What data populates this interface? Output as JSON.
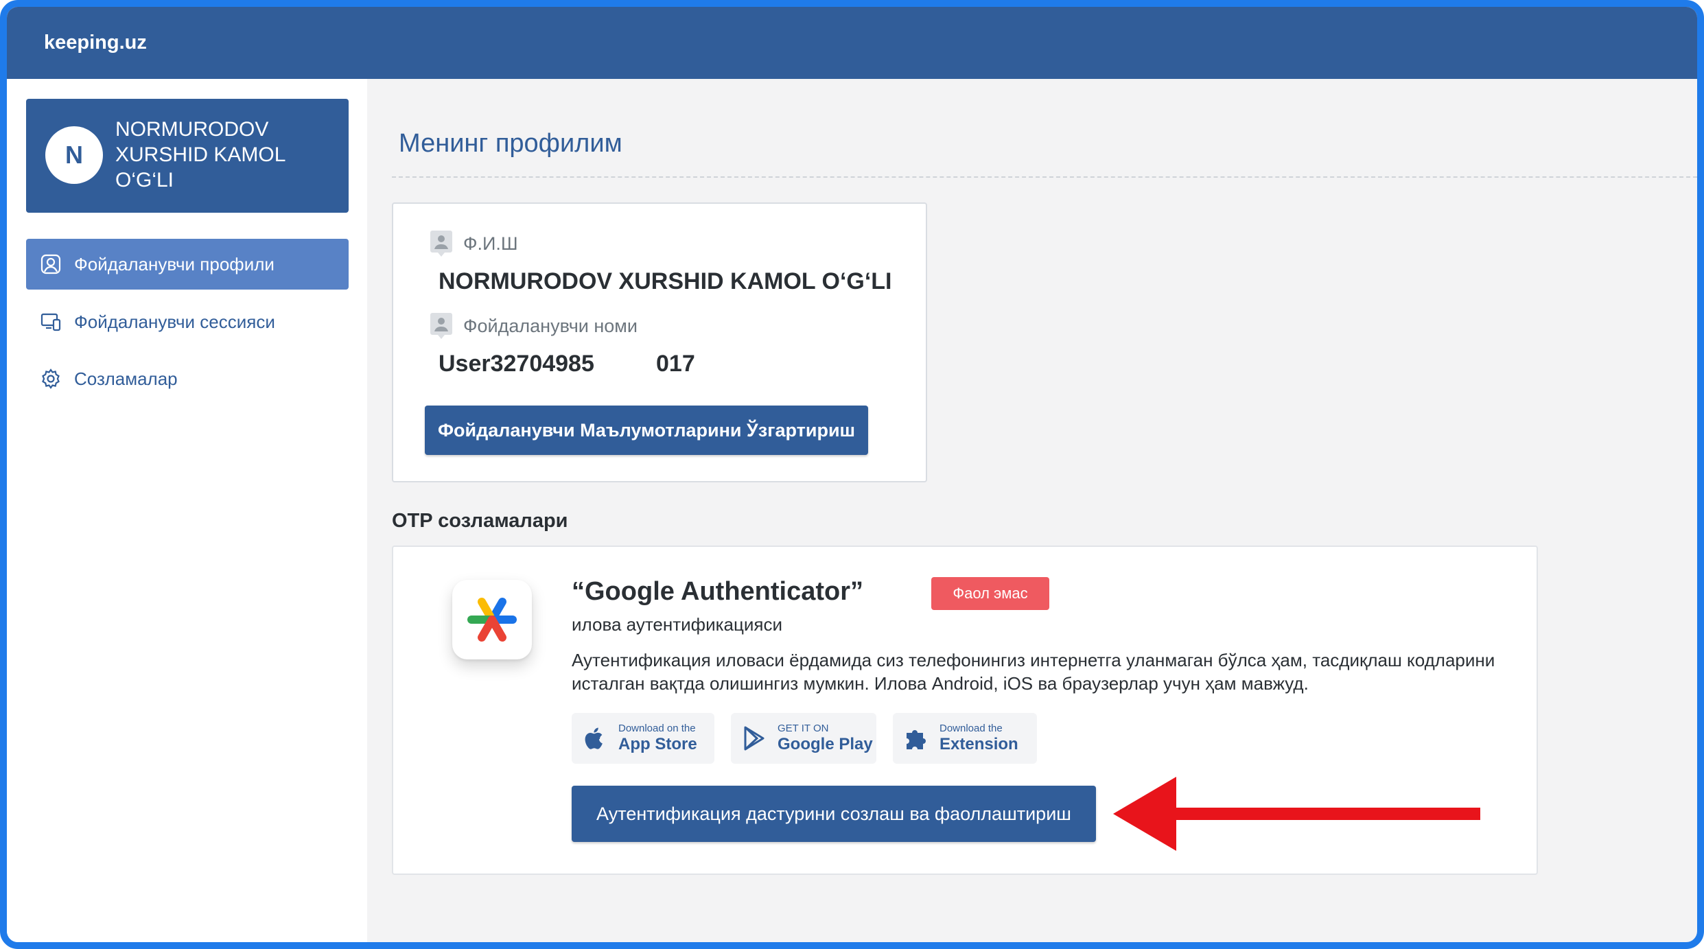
{
  "app": {
    "brand": "keeping.uz"
  },
  "sidebar": {
    "user": {
      "initial": "N",
      "name": "NORMURODOV XURSHID KAMOL O‘G‘LI"
    },
    "items": [
      {
        "label": "Фойдаланувчи профили",
        "icon": "user-square-icon",
        "active": true
      },
      {
        "label": "Фойдаланувчи сессияси",
        "icon": "devices-icon",
        "active": false
      },
      {
        "label": "Созламалар",
        "icon": "gear-icon",
        "active": false
      }
    ]
  },
  "main": {
    "title": "Менинг профилим",
    "profile": {
      "fio_label": "Ф.И.Ш",
      "fio_value": "NORMURODOV XURSHID KAMOL O‘G‘LI",
      "username_label": "Фойдаланувчи номи",
      "username_value": "User32704985",
      "username_suffix": "017",
      "edit_button": "Фойдаланувчи Маълумотларини Ўзгартириш"
    },
    "otp": {
      "section_title": "OTP созламалари",
      "app_title": "“Google Authenticator”",
      "status_badge": "Фаол эмас",
      "subtitle": "илова аутентификацияси",
      "description": "Аутентификация иловаси ёрдамида сиз телефонингиз интернетга уланмаган бўлса ҳам, тасдиқлаш кодларини исталган вақтда олишингиз мумкин. Илова Android, iOS ва браузерлар учун ҳам мавжуд.",
      "stores": [
        {
          "small": "Download on the",
          "big": "App Store",
          "icon": "apple-icon"
        },
        {
          "small": "GET IT ON",
          "big": "Google Play",
          "icon": "google-play-icon"
        },
        {
          "small": "Download the",
          "big": "Extension",
          "icon": "puzzle-icon"
        }
      ],
      "activate_button": "Аутентификация дастурини созлаш ва фаоллаштириш"
    }
  },
  "colors": {
    "primary": "#315d99",
    "active_nav": "#5882c6",
    "badge_red": "#ef5a60",
    "arrow_red": "#e8141b",
    "frame_blue": "#1f7bea"
  }
}
